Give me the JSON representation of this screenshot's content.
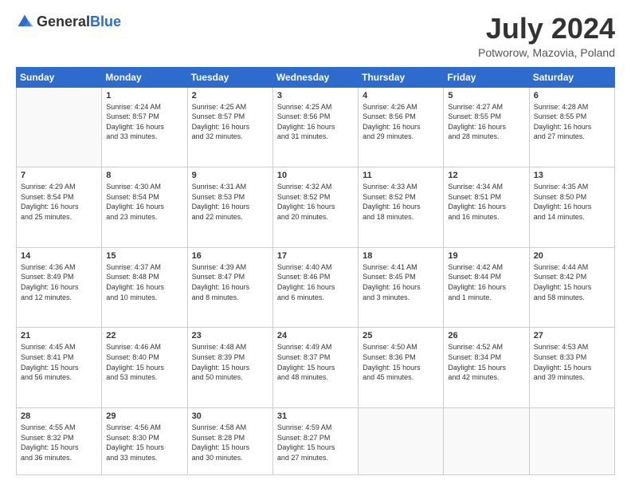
{
  "header": {
    "logo_general": "General",
    "logo_blue": "Blue",
    "month_year": "July 2024",
    "location": "Potworow, Mazovia, Poland"
  },
  "days_of_week": [
    "Sunday",
    "Monday",
    "Tuesday",
    "Wednesday",
    "Thursday",
    "Friday",
    "Saturday"
  ],
  "weeks": [
    [
      {
        "day": "",
        "info": ""
      },
      {
        "day": "1",
        "info": "Sunrise: 4:24 AM\nSunset: 8:57 PM\nDaylight: 16 hours\nand 33 minutes."
      },
      {
        "day": "2",
        "info": "Sunrise: 4:25 AM\nSunset: 8:57 PM\nDaylight: 16 hours\nand 32 minutes."
      },
      {
        "day": "3",
        "info": "Sunrise: 4:25 AM\nSunset: 8:56 PM\nDaylight: 16 hours\nand 31 minutes."
      },
      {
        "day": "4",
        "info": "Sunrise: 4:26 AM\nSunset: 8:56 PM\nDaylight: 16 hours\nand 29 minutes."
      },
      {
        "day": "5",
        "info": "Sunrise: 4:27 AM\nSunset: 8:55 PM\nDaylight: 16 hours\nand 28 minutes."
      },
      {
        "day": "6",
        "info": "Sunrise: 4:28 AM\nSunset: 8:55 PM\nDaylight: 16 hours\nand 27 minutes."
      }
    ],
    [
      {
        "day": "7",
        "info": "Sunrise: 4:29 AM\nSunset: 8:54 PM\nDaylight: 16 hours\nand 25 minutes."
      },
      {
        "day": "8",
        "info": "Sunrise: 4:30 AM\nSunset: 8:54 PM\nDaylight: 16 hours\nand 23 minutes."
      },
      {
        "day": "9",
        "info": "Sunrise: 4:31 AM\nSunset: 8:53 PM\nDaylight: 16 hours\nand 22 minutes."
      },
      {
        "day": "10",
        "info": "Sunrise: 4:32 AM\nSunset: 8:52 PM\nDaylight: 16 hours\nand 20 minutes."
      },
      {
        "day": "11",
        "info": "Sunrise: 4:33 AM\nSunset: 8:52 PM\nDaylight: 16 hours\nand 18 minutes."
      },
      {
        "day": "12",
        "info": "Sunrise: 4:34 AM\nSunset: 8:51 PM\nDaylight: 16 hours\nand 16 minutes."
      },
      {
        "day": "13",
        "info": "Sunrise: 4:35 AM\nSunset: 8:50 PM\nDaylight: 16 hours\nand 14 minutes."
      }
    ],
    [
      {
        "day": "14",
        "info": "Sunrise: 4:36 AM\nSunset: 8:49 PM\nDaylight: 16 hours\nand 12 minutes."
      },
      {
        "day": "15",
        "info": "Sunrise: 4:37 AM\nSunset: 8:48 PM\nDaylight: 16 hours\nand 10 minutes."
      },
      {
        "day": "16",
        "info": "Sunrise: 4:39 AM\nSunset: 8:47 PM\nDaylight: 16 hours\nand 8 minutes."
      },
      {
        "day": "17",
        "info": "Sunrise: 4:40 AM\nSunset: 8:46 PM\nDaylight: 16 hours\nand 6 minutes."
      },
      {
        "day": "18",
        "info": "Sunrise: 4:41 AM\nSunset: 8:45 PM\nDaylight: 16 hours\nand 3 minutes."
      },
      {
        "day": "19",
        "info": "Sunrise: 4:42 AM\nSunset: 8:44 PM\nDaylight: 16 hours\nand 1 minute."
      },
      {
        "day": "20",
        "info": "Sunrise: 4:44 AM\nSunset: 8:42 PM\nDaylight: 15 hours\nand 58 minutes."
      }
    ],
    [
      {
        "day": "21",
        "info": "Sunrise: 4:45 AM\nSunset: 8:41 PM\nDaylight: 15 hours\nand 56 minutes."
      },
      {
        "day": "22",
        "info": "Sunrise: 4:46 AM\nSunset: 8:40 PM\nDaylight: 15 hours\nand 53 minutes."
      },
      {
        "day": "23",
        "info": "Sunrise: 4:48 AM\nSunset: 8:39 PM\nDaylight: 15 hours\nand 50 minutes."
      },
      {
        "day": "24",
        "info": "Sunrise: 4:49 AM\nSunset: 8:37 PM\nDaylight: 15 hours\nand 48 minutes."
      },
      {
        "day": "25",
        "info": "Sunrise: 4:50 AM\nSunset: 8:36 PM\nDaylight: 15 hours\nand 45 minutes."
      },
      {
        "day": "26",
        "info": "Sunrise: 4:52 AM\nSunset: 8:34 PM\nDaylight: 15 hours\nand 42 minutes."
      },
      {
        "day": "27",
        "info": "Sunrise: 4:53 AM\nSunset: 8:33 PM\nDaylight: 15 hours\nand 39 minutes."
      }
    ],
    [
      {
        "day": "28",
        "info": "Sunrise: 4:55 AM\nSunset: 8:32 PM\nDaylight: 15 hours\nand 36 minutes."
      },
      {
        "day": "29",
        "info": "Sunrise: 4:56 AM\nSunset: 8:30 PM\nDaylight: 15 hours\nand 33 minutes."
      },
      {
        "day": "30",
        "info": "Sunrise: 4:58 AM\nSunset: 8:28 PM\nDaylight: 15 hours\nand 30 minutes."
      },
      {
        "day": "31",
        "info": "Sunrise: 4:59 AM\nSunset: 8:27 PM\nDaylight: 15 hours\nand 27 minutes."
      },
      {
        "day": "",
        "info": ""
      },
      {
        "day": "",
        "info": ""
      },
      {
        "day": "",
        "info": ""
      }
    ]
  ]
}
